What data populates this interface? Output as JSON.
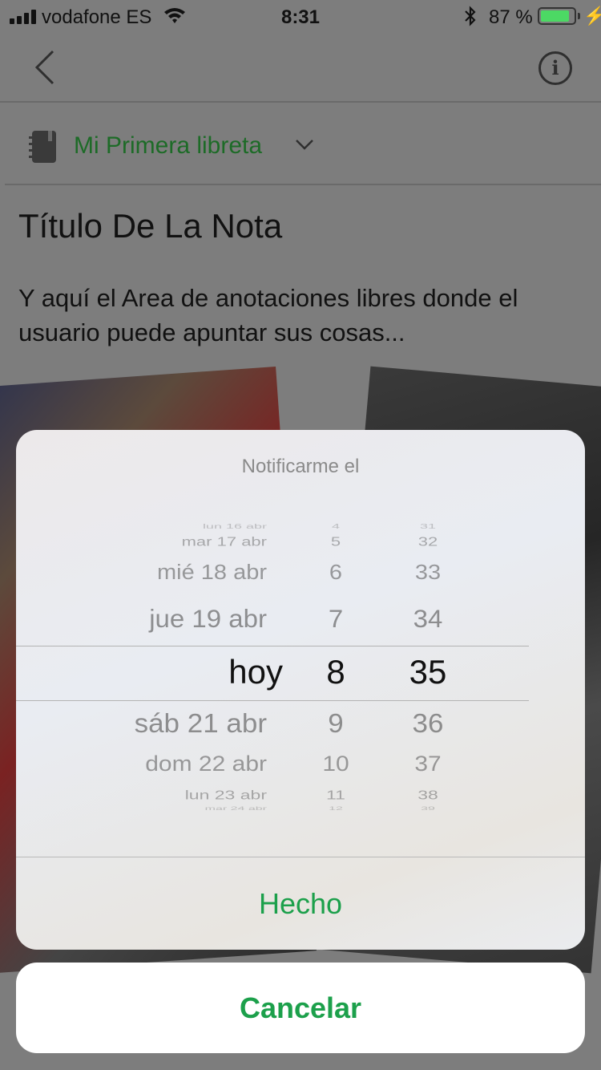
{
  "status_bar": {
    "carrier": "vodafone ES",
    "time": "8:31",
    "battery_percent": "87 %",
    "battery_level": 0.87,
    "battery_color": "#4cd964"
  },
  "nav": {
    "back_icon": "chevron-left-icon",
    "info_icon": "info-icon"
  },
  "notebook": {
    "name": "Mi Primera libreta",
    "icon": "notebook-icon",
    "color": "#1d6b27"
  },
  "note": {
    "title": "Título De La Nota",
    "body": "Y aquí el Area de anotaciones libres donde el usuario puede apuntar sus cosas..."
  },
  "sheet": {
    "title": "Notificarme el",
    "picker": {
      "dates": [
        "lun 16 abr",
        "mar 17 abr",
        "mié 18 abr",
        "jue 19 abr",
        "hoy",
        "sáb 21 abr",
        "dom 22 abr",
        "lun 23 abr",
        "mar 24 abr"
      ],
      "hours": [
        "4",
        "5",
        "6",
        "7",
        "8",
        "9",
        "10",
        "11",
        "12"
      ],
      "minutes": [
        "31",
        "32",
        "33",
        "34",
        "35",
        "36",
        "37",
        "38",
        "39"
      ],
      "selected": {
        "date": "hoy",
        "hour": "8",
        "minute": "35"
      }
    },
    "done_label": "Hecho"
  },
  "cancel_label": "Cancelar",
  "accent_color": "#1ca04b"
}
